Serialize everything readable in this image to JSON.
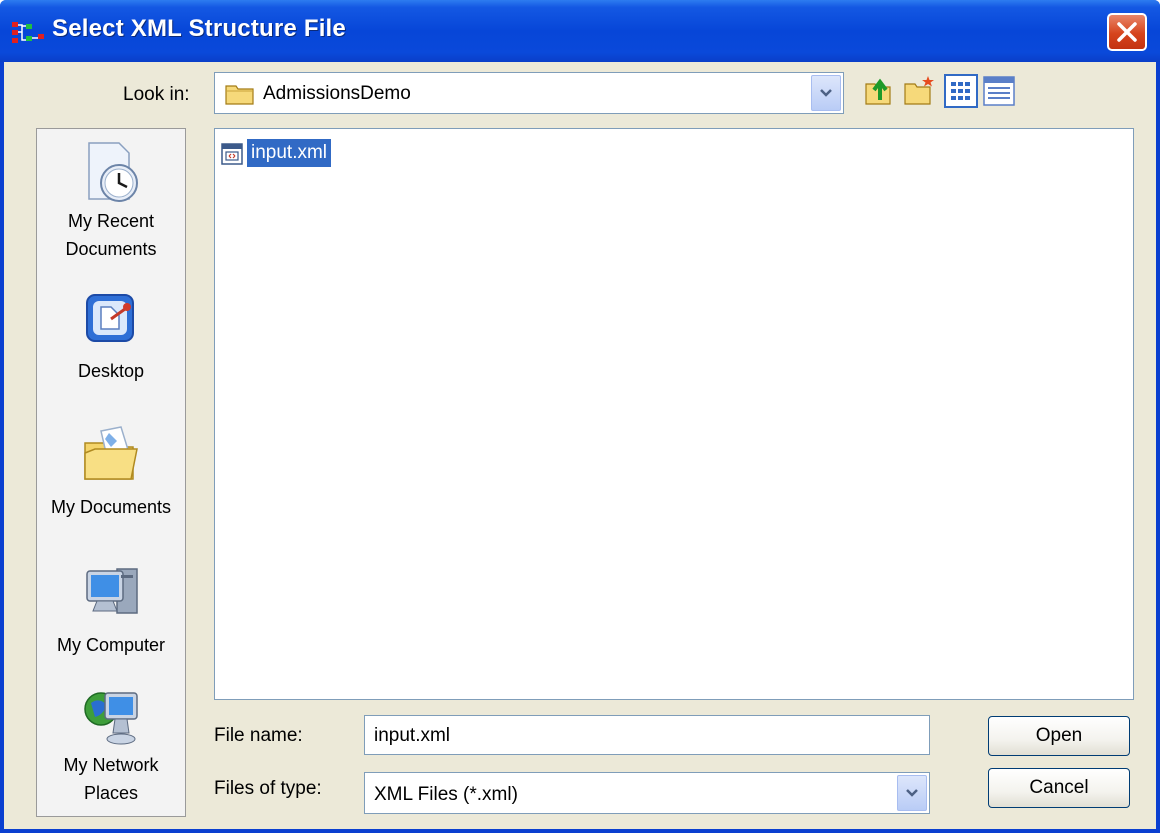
{
  "window": {
    "title": "Select XML Structure File"
  },
  "look_in": {
    "label": "Look in:",
    "value": "AdmissionsDemo"
  },
  "toolbar": {
    "icons": [
      "up-one-level-icon",
      "create-new-folder-icon",
      "list-view-icon",
      "details-view-icon"
    ]
  },
  "places": [
    {
      "label_line1": "My Recent",
      "label_line2": "Documents",
      "icon": "recent-documents-icon"
    },
    {
      "label_line1": "Desktop",
      "label_line2": "",
      "icon": "desktop-icon"
    },
    {
      "label_line1": "My Documents",
      "label_line2": "",
      "icon": "my-documents-icon"
    },
    {
      "label_line1": "My Computer",
      "label_line2": "",
      "icon": "my-computer-icon"
    },
    {
      "label_line1": "My Network",
      "label_line2": "Places",
      "icon": "network-places-icon"
    }
  ],
  "files": [
    {
      "name": "input.xml",
      "selected": true
    }
  ],
  "file_name": {
    "label": "File name:",
    "value": "input.xml"
  },
  "file_type": {
    "label": "Files of type:",
    "value": "XML Files (*.xml)"
  },
  "buttons": {
    "open": "Open",
    "cancel": "Cancel"
  }
}
